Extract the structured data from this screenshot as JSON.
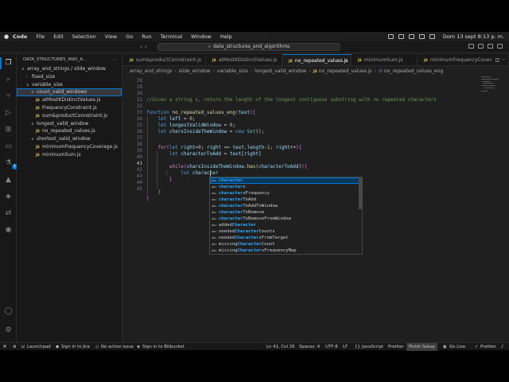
{
  "menubar": {
    "items": [
      "Code",
      "File",
      "Edit",
      "Selection",
      "View",
      "Go",
      "Run",
      "Terminal",
      "Window",
      "Help"
    ],
    "clock": "Dom 13 sept 8:13 p. m."
  },
  "titlebar": {
    "command_center": "data_structures_and_algorithms"
  },
  "sidebar": {
    "header": "DATA_STRUCTURES_AND_A...",
    "tree": [
      {
        "label": "array_and_strings / slide_window",
        "indent": 0,
        "chev": "∨",
        "type": "folder"
      },
      {
        "label": "fixed_size",
        "indent": 1,
        "chev": "›",
        "type": "folder"
      },
      {
        "label": "variable_size",
        "indent": 1,
        "chev": "∨",
        "type": "folder"
      },
      {
        "label": "count_valid_windows",
        "indent": 2,
        "chev": "∨",
        "type": "folder",
        "selected": true
      },
      {
        "label": "atMostKDistinctValues.js",
        "indent": 3,
        "type": "file"
      },
      {
        "label": "FrequencyConstraint.js",
        "indent": 3,
        "type": "file"
      },
      {
        "label": "sum&productConnstraint.js",
        "indent": 3,
        "type": "file"
      },
      {
        "label": "longest_valid_window",
        "indent": 2,
        "chev": "∨",
        "type": "folder"
      },
      {
        "label": "no_repeated_values.js",
        "indent": 3,
        "type": "file"
      },
      {
        "label": "shortest_valid_window",
        "indent": 2,
        "chev": "∨",
        "type": "folder"
      },
      {
        "label": "minimumFrequencyCoverage.js",
        "indent": 3,
        "type": "file"
      },
      {
        "label": "minimumSum.js",
        "indent": 3,
        "type": "file"
      }
    ]
  },
  "tabs": [
    {
      "label": "sum&productConnstraint.js",
      "active": false
    },
    {
      "label": "atMostKDistinctValues.js",
      "active": false
    },
    {
      "label": "no_repeated_values.js",
      "active": true
    },
    {
      "label": "minimumSum.js",
      "active": false
    },
    {
      "label": "minimumFrequencyCovera",
      "active": false
    }
  ],
  "breadcrumb": [
    "array_and_strings",
    "slide_window",
    "variable_size",
    "longest_valid_window",
    "no_repeated_values.js",
    "no_repeated_values_eng"
  ],
  "editor": {
    "line_numbers": [
      "28",
      "29",
      "30",
      "31",
      "32",
      "33",
      "34",
      "35",
      "36",
      "37",
      "38",
      "39",
      "40",
      "41",
      "42",
      "43",
      "44",
      "45"
    ],
    "comment": "//Given a string s, return the length of the longest contiguous substring with no repeated characters",
    "func_name": "no_repeated_values_eng",
    "param": "text",
    "var_left": "left",
    "var_longest": "longestValidWindow",
    "var_chars": "charsInsideTheWindow",
    "cls_set": "Set",
    "var_right": "right",
    "var_ctadd": "characterToAdd",
    "method_has": "has",
    "typed": "character",
    "typed_prefix": "let"
  },
  "suggestions": [
    {
      "pre": "",
      "match": "character",
      "post": "",
      "selected": true
    },
    {
      "pre": "",
      "match": "character",
      "post": "s"
    },
    {
      "pre": "",
      "match": "character",
      "post": "sFrequency"
    },
    {
      "pre": "",
      "match": "character",
      "post": "ToAdd"
    },
    {
      "pre": "",
      "match": "character",
      "post": "ToAddToWindow"
    },
    {
      "pre": "",
      "match": "character",
      "post": "ToRemove"
    },
    {
      "pre": "",
      "match": "character",
      "post": "ToRemoveFromWindow"
    },
    {
      "pre": "added",
      "match": "Character",
      "post": ""
    },
    {
      "pre": "needed",
      "match": "Character",
      "post": "Counts"
    },
    {
      "pre": "needed",
      "match": "Character",
      "post": "sFromTarget"
    },
    {
      "pre": "missing",
      "match": "Character",
      "post": "Count"
    },
    {
      "pre": "missing",
      "match": "Character",
      "post": "sFrequencyMap"
    }
  ],
  "statusbar": {
    "launchpad": "Launchpad",
    "jira": "Sign in to Jira",
    "issue": "No active issue",
    "bitbucket": "Sign in to Bitbucket",
    "position": "Ln 41, Col 26",
    "spaces": "Spaces: 4",
    "encoding": "UTF-8",
    "eol": "LF",
    "language": "JavaScript",
    "prettier": "Prettier",
    "finish": "Finish Setup",
    "golive": "Go Live",
    "prettier2": "Prettier"
  },
  "colors": {
    "accent": "#0078d4",
    "background": "#1f1f1f",
    "keyword": "#569cd6",
    "function": "#dcdcaa",
    "variable": "#9cdcfe",
    "comment": "#6a9955"
  }
}
